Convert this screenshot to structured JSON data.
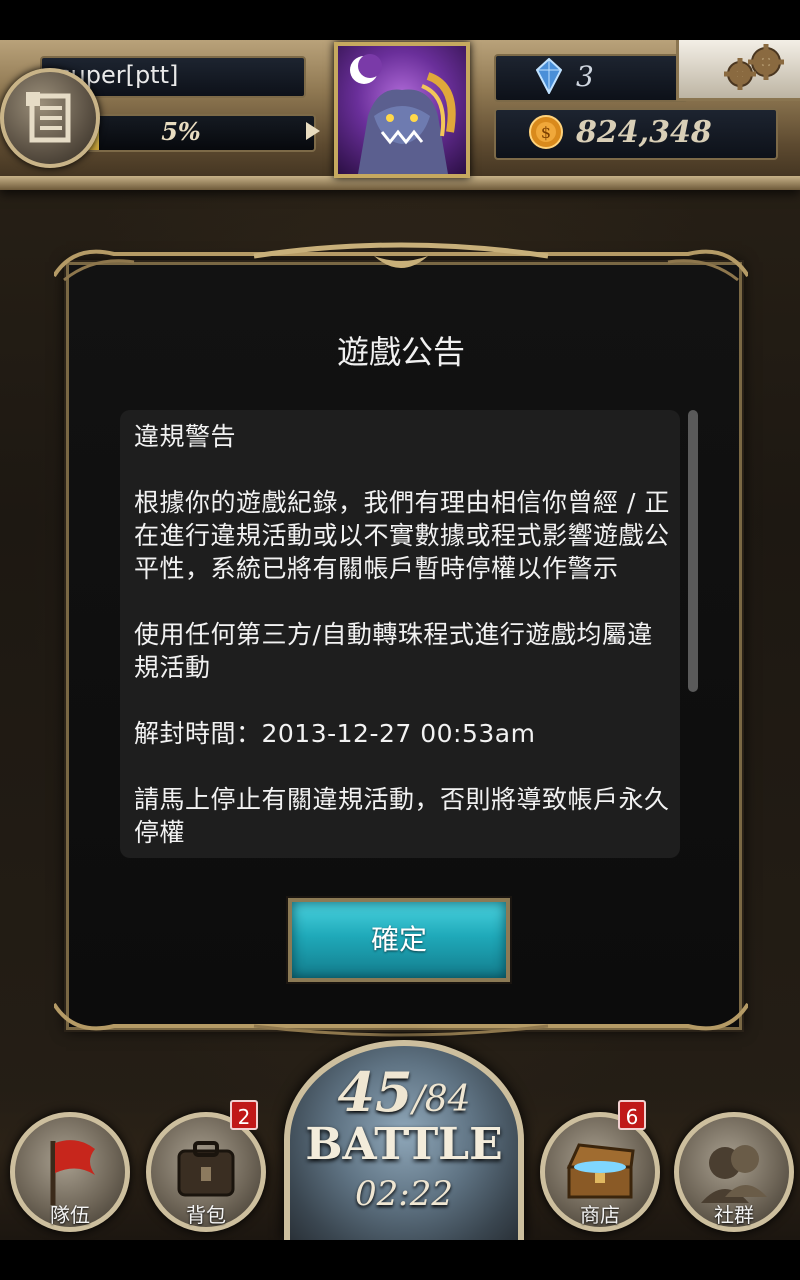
{
  "header": {
    "player_name": "super[ptt]",
    "exp_percent": 5,
    "exp_label": "5%",
    "gems": "3",
    "gold": "824,348"
  },
  "dialog": {
    "title": "遊戲公告",
    "paragraphs": [
      "違規警告",
      "根據你的遊戲紀錄，我們有理由相信你曾經 / 正在進行違規活動或以不實數據或程式影響遊戲公平性，系統已將有關帳戶暫時停權以作警示",
      "使用任何第三方/自動轉珠程式進行遊戲均屬違規活動",
      "解封時間：2013-12-27 00:53am",
      "請馬上停止有關違規活動，否則將導致帳戶永久停權"
    ],
    "confirm_label": "確定"
  },
  "bottom_nav": {
    "team_label": "隊伍",
    "bag_label": "背包",
    "bag_badge": "2",
    "shop_label": "商店",
    "shop_badge": "6",
    "social_label": "社群",
    "stamina_current": "45",
    "stamina_max": "84",
    "battle_label": "BATTLE",
    "timer": "02:22"
  },
  "icons": {
    "menu": "menu-book-icon",
    "gem": "diamond-icon",
    "gold": "coin-icon",
    "settings": "gear-icon",
    "team": "flag-icon",
    "bag": "backpack-icon",
    "shop": "treasure-chest-icon",
    "social": "people-icon"
  },
  "colors": {
    "accent_teal": "#1fa9b9",
    "frame_gold": "#c6a95f",
    "badge_red": "#c01818"
  }
}
